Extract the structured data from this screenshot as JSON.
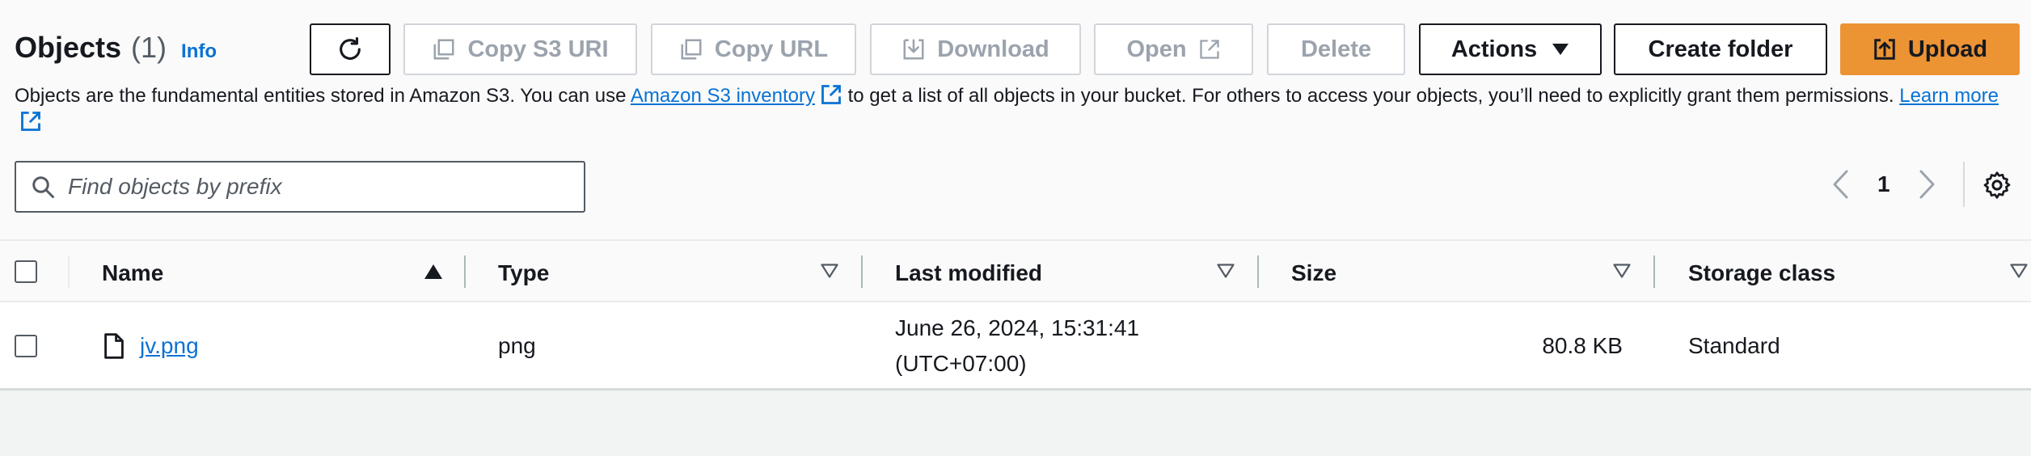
{
  "header": {
    "title": "Objects",
    "count": "(1)",
    "info_label": "Info"
  },
  "toolbar": {
    "refresh_icon": "refresh-icon",
    "copy_s3_uri_label": "Copy S3 URI",
    "copy_url_label": "Copy URL",
    "download_label": "Download",
    "open_label": "Open",
    "delete_label": "Delete",
    "actions_label": "Actions",
    "create_folder_label": "Create folder",
    "upload_label": "Upload"
  },
  "description": {
    "text_before": "Objects are the fundamental entities stored in Amazon S3. You can use ",
    "inventory_link": "Amazon S3 inventory",
    "text_after": " to get a list of all objects in your bucket. For others to access your objects, you’ll need to explicitly grant them permissions. ",
    "learn_more_link": "Learn more"
  },
  "search": {
    "placeholder": "Find objects by prefix",
    "value": ""
  },
  "pagination": {
    "current_page": "1"
  },
  "table": {
    "columns": [
      "Name",
      "Type",
      "Last modified",
      "Size",
      "Storage class"
    ],
    "rows": [
      {
        "name": "jv.png",
        "type": "png",
        "last_modified_line1": "June 26, 2024, 15:31:41",
        "last_modified_line2": "(UTC+07:00)",
        "size": "80.8 KB",
        "storage_class": "Standard"
      }
    ]
  },
  "colors": {
    "accent_link": "#0972d3",
    "upload_button": "#ec9334",
    "disabled_text": "#9ba3ad",
    "text": "#16191f"
  }
}
